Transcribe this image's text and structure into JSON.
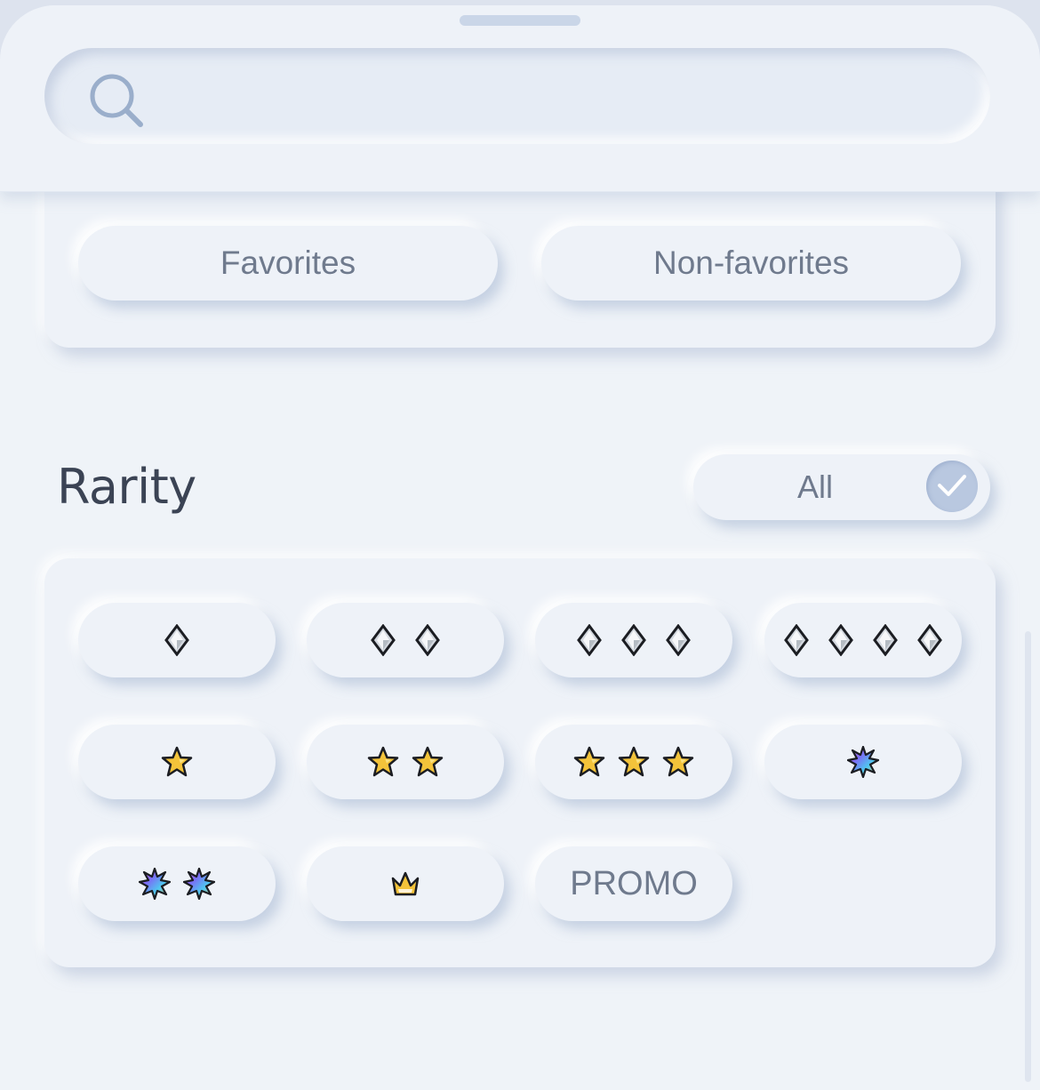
{
  "search": {
    "placeholder": "",
    "icon": "search-icon"
  },
  "filters": {
    "favorites_label": "Favorites",
    "non_favorites_label": "Non-favorites"
  },
  "rarity": {
    "title": "Rarity",
    "all_label": "All",
    "all_selected": true,
    "options": [
      {
        "id": "diamond-1",
        "symbol": "diamond",
        "count": 1
      },
      {
        "id": "diamond-2",
        "symbol": "diamond",
        "count": 2
      },
      {
        "id": "diamond-3",
        "symbol": "diamond",
        "count": 3
      },
      {
        "id": "diamond-4",
        "symbol": "diamond",
        "count": 4
      },
      {
        "id": "star-1",
        "symbol": "star",
        "count": 1
      },
      {
        "id": "star-2",
        "symbol": "star",
        "count": 2
      },
      {
        "id": "star-3",
        "symbol": "star",
        "count": 3
      },
      {
        "id": "shiny-1",
        "symbol": "shiny-star",
        "count": 1
      },
      {
        "id": "shiny-2",
        "symbol": "shiny-star",
        "count": 2
      },
      {
        "id": "crown-1",
        "symbol": "crown",
        "count": 1
      },
      {
        "id": "promo",
        "symbol": "text",
        "label": "PROMO"
      }
    ]
  },
  "colors": {
    "background": "#eff3f8",
    "text": "#6f7a8d",
    "heading": "#3b4354",
    "accent": "#b9c8e0",
    "star_gold": "#f3c33a",
    "diamond_silver": "#c9ced6"
  }
}
